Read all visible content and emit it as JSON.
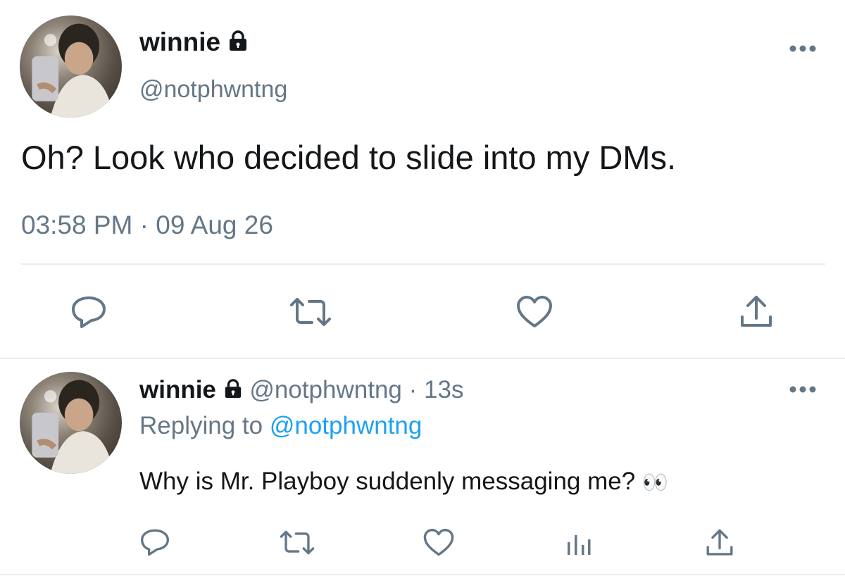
{
  "main_tweet": {
    "display_name": "winnie",
    "handle": "@notphwntng",
    "text": "Oh? Look who decided to slide into my DMs.",
    "timestamp": "03:58 PM · 09 Aug 26"
  },
  "reply_tweet": {
    "display_name": "winnie",
    "handle": "@notphwntng",
    "separator": "·",
    "age": "13s",
    "replying_prefix": "Replying to",
    "replying_to": "@notphwntng",
    "text": "Why is Mr. Playboy suddenly messaging me?",
    "emoji": "👀"
  },
  "colors": {
    "text": "#14171a",
    "muted": "#657786",
    "link": "#1da1f2",
    "divider": "#e6ecf0"
  },
  "icons": [
    "lock-icon",
    "more-icon",
    "reply-icon",
    "retweet-icon",
    "like-icon",
    "share-icon",
    "analytics-icon"
  ]
}
